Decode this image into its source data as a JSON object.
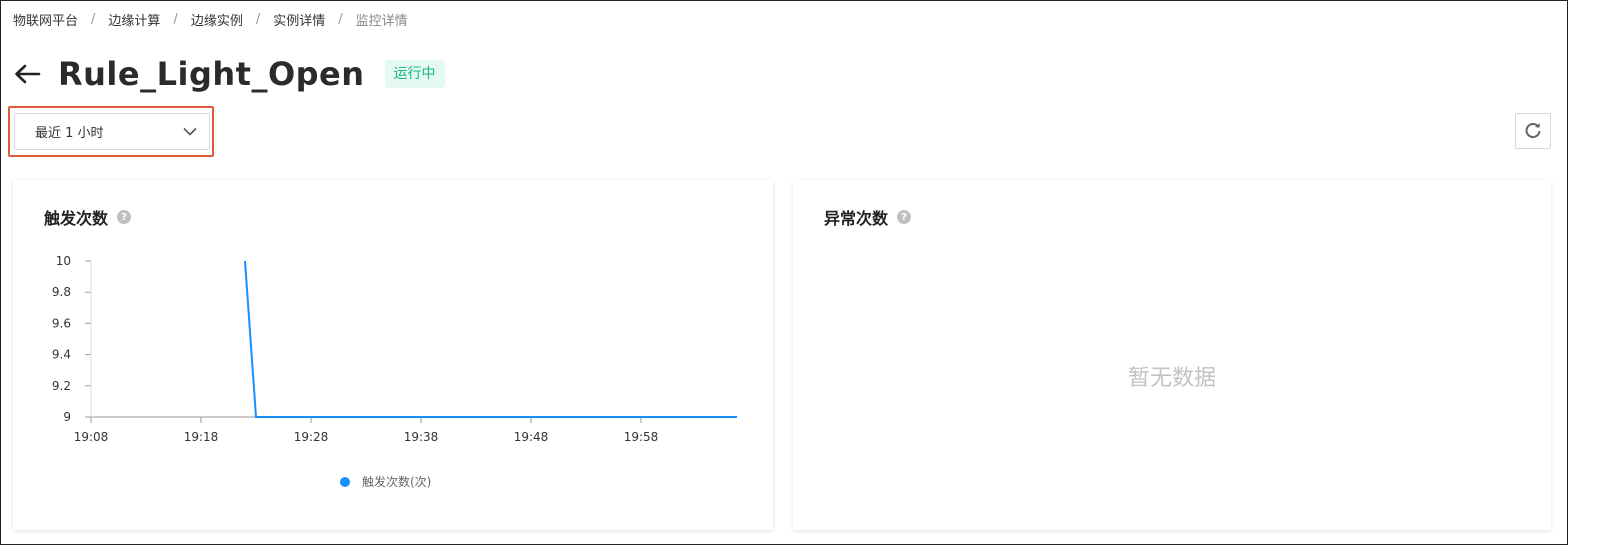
{
  "breadcrumb": {
    "items": [
      "物联网平台",
      "边缘计算",
      "边缘实例",
      "实例详情",
      "监控详情"
    ],
    "separator": "/"
  },
  "header": {
    "title": "Rule_Light_Open",
    "status": "运行中",
    "status_color": "#18b68a"
  },
  "toolbar": {
    "time_range": "最近 1 小时",
    "refresh_icon": "refresh-icon"
  },
  "trigger_card": {
    "title": "触发次数",
    "help_icon": "question-circle-icon"
  },
  "error_card": {
    "title": "异常次数",
    "help_icon": "question-circle-icon",
    "empty_text": "暂无数据"
  },
  "chart_data": {
    "type": "line",
    "title": "",
    "xlabel": "",
    "ylabel": "",
    "x_ticks": [
      "19:08",
      "19:18",
      "19:28",
      "19:38",
      "19:48",
      "19:58"
    ],
    "y_ticks": [
      9,
      9.2,
      9.4,
      9.6,
      9.8,
      10
    ],
    "ylim": [
      9,
      10
    ],
    "series": [
      {
        "name": "触发次数(次)",
        "color": "#1890ff",
        "points": [
          {
            "x": "19:22",
            "y": 10
          },
          {
            "x": "19:23",
            "y": 9
          },
          {
            "x": "20:07",
            "y": 9
          }
        ]
      }
    ],
    "legend_position": "bottom-center",
    "grid": false
  }
}
